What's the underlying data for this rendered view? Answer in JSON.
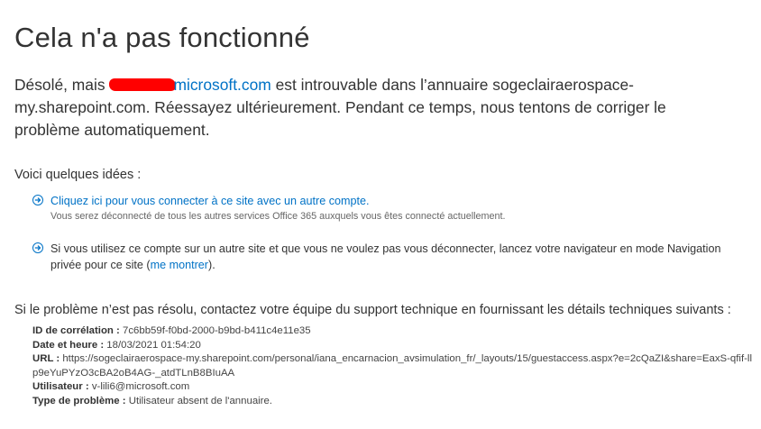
{
  "title": "Cela n'a pas fonctionné",
  "message": {
    "prefix": "Désolé, mais",
    "email_suffix": "microsoft.com",
    "rest": " est introuvable dans l’annuaire sogeclairaerospace-my.sharepoint.com. Réessayez ultérieurement. Pendant ce temps, nous tentons de corriger le problème automatiquement."
  },
  "ideas_title": "Voici quelques idées :",
  "ideas": [
    {
      "link": "Cliquez ici pour vous connecter à ce site avec un autre compte.",
      "sub": "Vous serez déconnecté de tous les autres services Office 365 auxquels vous êtes connecté actuellement."
    },
    {
      "text": "Si vous utilisez ce compte sur un autre site et que vous ne voulez pas vous déconnecter, lancez votre navigateur en mode Navigation privée pour ce site (",
      "link": "me montrer",
      "text_end": ")."
    }
  ],
  "support_text": "Si le problème n’est pas résolu, contactez votre équipe du support technique en fournissant les détails techniques suivants :",
  "details": {
    "correlation_label": "ID de corrélation :",
    "correlation_value": "7c6bb59f-f0bd-2000-b9bd-b411c4e11e35",
    "datetime_label": "Date et heure :",
    "datetime_value": "18/03/2021 01:54:20",
    "url_label": "URL :",
    "url_value": "https://sogeclairaerospace-my.sharepoint.com/personal/iana_encarnacion_avsimulation_fr/_layouts/15/guestaccess.aspx?e=2cQaZI&share=EaxS-qfif-llp9eYuPYzO3cBA2oB4AG-_atdTLnB8BIuAA",
    "user_label": "Utilisateur :",
    "user_value": "v-lili6@microsoft.com",
    "problem_label": "Type de problème :",
    "problem_value": "Utilisateur absent de l'annuaire."
  },
  "colors": {
    "link": "#0072c6",
    "text": "#333333",
    "redaction": "#ff0000"
  },
  "icons": [
    "circle-arrow-right-icon"
  ]
}
